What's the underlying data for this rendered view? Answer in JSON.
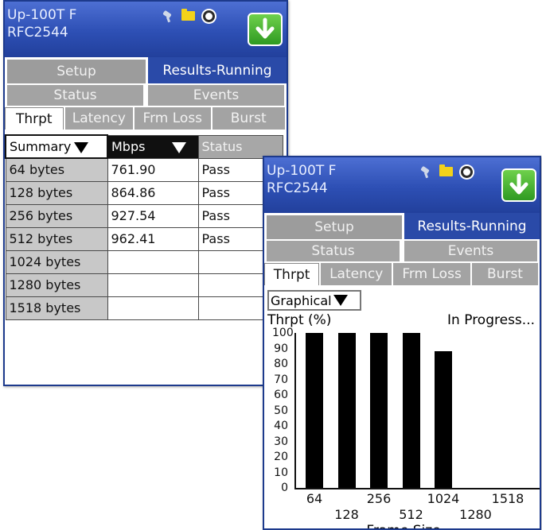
{
  "screen1": {
    "title_line1": "Up-100T F",
    "title_line2": "RFC2544",
    "main_tabs": [
      {
        "label": "Setup"
      },
      {
        "label": "Results-Running"
      }
    ],
    "sub_tabs": [
      {
        "label": "Status"
      },
      {
        "label": "Events"
      }
    ],
    "test_tabs": [
      {
        "label": "Thrpt"
      },
      {
        "label": "Latency"
      },
      {
        "label": "Frm Loss"
      },
      {
        "label": "Burst"
      }
    ],
    "table": {
      "headers": [
        "Summary",
        "Mbps",
        "Status"
      ],
      "rows": [
        {
          "size": "64 bytes",
          "mbps": "761.90",
          "status": "Pass"
        },
        {
          "size": "128 bytes",
          "mbps": "864.86",
          "status": "Pass"
        },
        {
          "size": "256 bytes",
          "mbps": "927.54",
          "status": "Pass"
        },
        {
          "size": "512 bytes",
          "mbps": "962.41",
          "status": "Pass"
        },
        {
          "size": "1024 bytes",
          "mbps": "",
          "status": ""
        },
        {
          "size": "1280 bytes",
          "mbps": "",
          "status": ""
        },
        {
          "size": "1518 bytes",
          "mbps": "",
          "status": ""
        }
      ]
    }
  },
  "screen2": {
    "title_line1": "Up-100T F",
    "title_line2": "RFC2544",
    "main_tabs": [
      {
        "label": "Setup"
      },
      {
        "label": "Results-Running"
      }
    ],
    "sub_tabs": [
      {
        "label": "Status"
      },
      {
        "label": "Events"
      }
    ],
    "test_tabs": [
      {
        "label": "Thrpt"
      },
      {
        "label": "Latency"
      },
      {
        "label": "Frm Loss"
      },
      {
        "label": "Burst"
      }
    ],
    "view_select": "Graphical",
    "progress_text": "In Progress..."
  },
  "icons": [
    "plug-icon",
    "folder-icon",
    "gear-icon",
    "download-arrow-icon"
  ],
  "colors": {
    "titlebar": "#2d4fb4",
    "active_tab": "#2a4aa8",
    "save_button": "#3fae2c",
    "inactive_tab": "#9c9c9c"
  },
  "chart_data": {
    "type": "bar",
    "ylabel": "Thrpt (%)",
    "xlabel": "Frame Size",
    "ylim": [
      0,
      100
    ],
    "yticks": [
      "100",
      "90",
      "80",
      "70",
      "60",
      "50",
      "40",
      "30",
      "20",
      "10",
      "0"
    ],
    "categories": [
      "64",
      "128",
      "256",
      "512",
      "1024",
      "1280",
      "1518"
    ],
    "values": [
      100,
      100,
      100,
      100,
      88,
      null,
      null
    ]
  }
}
